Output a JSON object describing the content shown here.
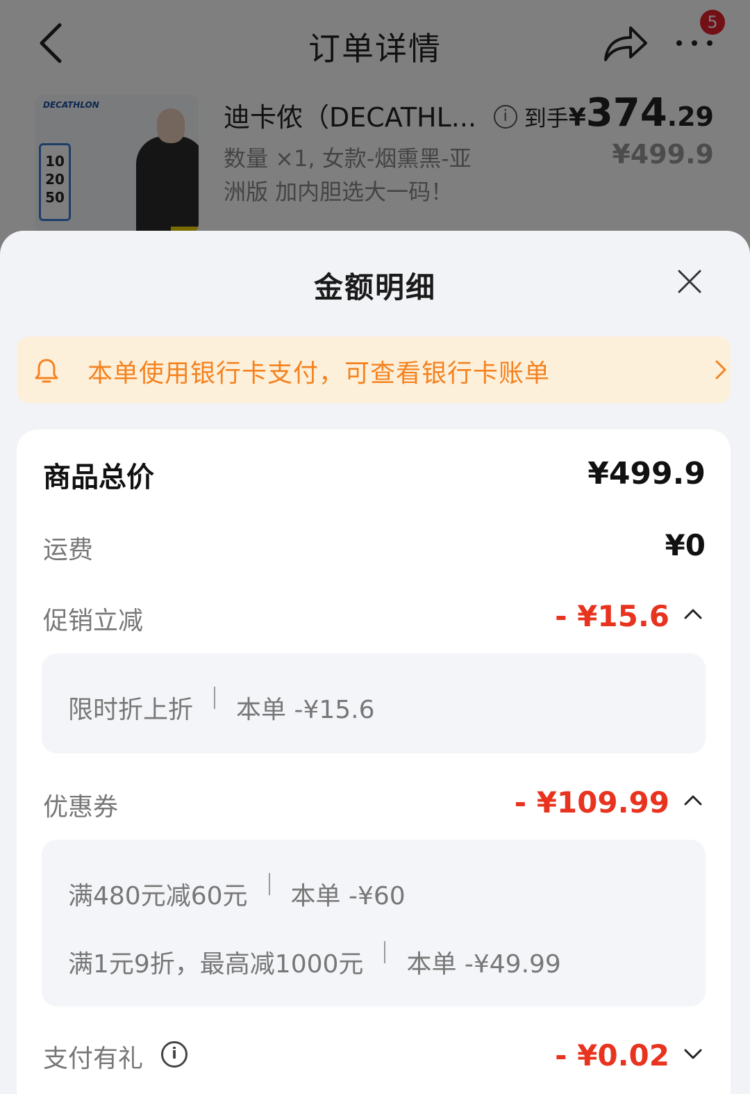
{
  "header": {
    "title": "订单详情",
    "more_badge": "5"
  },
  "product": {
    "name": "迪卡侬（DECATHL...",
    "spec": "数量 ×1, 女款-烟熏黑-亚洲版 加内胆选大一码！",
    "price_label": "到手",
    "price_currency": "¥",
    "price_integer": "374",
    "price_decimal": ".29",
    "original_price": "¥499.9",
    "thumbnail": {
      "brand": "DECATHLON",
      "card_values": [
        "10",
        "20",
        "50"
      ]
    }
  },
  "sheet": {
    "title": "金额明细",
    "notice": "本单使用银行卡支付，可查看银行卡账单",
    "rows": {
      "total": {
        "label": "商品总价",
        "value": "¥499.9"
      },
      "shipping": {
        "label": "运费",
        "value": "¥0"
      },
      "promo": {
        "label": "促销立减",
        "value": "- ¥15.6",
        "details": [
          {
            "name": "限时折上折",
            "amount": "本单 -¥15.6"
          }
        ]
      },
      "coupon": {
        "label": "优惠券",
        "value": "- ¥109.99",
        "details": [
          {
            "name": "满480元减60元",
            "amount": "本单 -¥60"
          },
          {
            "name": "满1元9折，最高减1000元",
            "amount": "本单 -¥49.99"
          }
        ]
      },
      "pay_gift": {
        "label": "支付有礼",
        "value": "- ¥0.02"
      }
    }
  },
  "colors": {
    "accent_red": "#e8331f",
    "notice_orange": "#f5821f",
    "notice_bg": "#fdf0da",
    "badge_red": "#e4202c"
  }
}
